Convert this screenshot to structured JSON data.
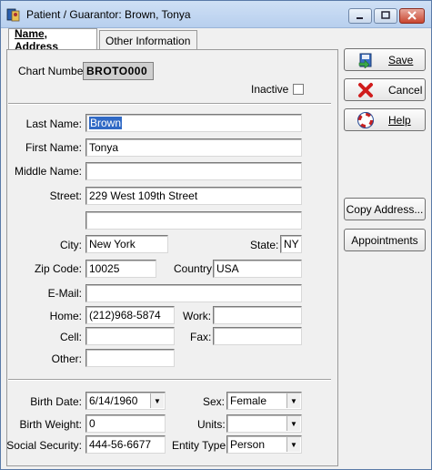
{
  "window": {
    "title": "Patient / Guarantor: Brown, Tonya",
    "minimize_icon": "minimize-icon",
    "maximize_icon": "maximize-icon",
    "close_icon": "close-icon"
  },
  "tabs": [
    {
      "label": "Name, Address",
      "active": true
    },
    {
      "label": "Other Information",
      "active": false
    }
  ],
  "chart": {
    "label": "Chart Number:",
    "value": "BROTO000"
  },
  "inactive": {
    "label": "Inactive",
    "checked": false
  },
  "name_address": {
    "last_name": {
      "label": "Last Name:",
      "value": "Brown"
    },
    "first_name": {
      "label": "First Name:",
      "value": "Tonya"
    },
    "middle_name": {
      "label": "Middle Name:",
      "value": ""
    },
    "street": {
      "label": "Street:",
      "value": "229 West 109th Street",
      "value2": ""
    },
    "city": {
      "label": "City:",
      "value": "New York"
    },
    "state": {
      "label": "State:",
      "value": "NY"
    },
    "zip": {
      "label": "Zip Code:",
      "value": "10025"
    },
    "country": {
      "label": "Country:",
      "value": "USA"
    },
    "email": {
      "label": "E-Mail:",
      "value": ""
    },
    "home": {
      "label": "Home:",
      "value": "(212)968-5874"
    },
    "work": {
      "label": "Work:",
      "value": ""
    },
    "cell": {
      "label": "Cell:",
      "value": ""
    },
    "fax": {
      "label": "Fax:",
      "value": ""
    },
    "other": {
      "label": "Other:",
      "value": ""
    }
  },
  "demographics": {
    "birth_date": {
      "label": "Birth Date:",
      "value": "6/14/1960"
    },
    "sex": {
      "label": "Sex:",
      "value": "Female"
    },
    "birth_weight": {
      "label": "Birth Weight:",
      "value": "0"
    },
    "units": {
      "label": "Units:",
      "value": ""
    },
    "ssn": {
      "label": "Social Security:",
      "value": "444-56-6677"
    },
    "entity_type": {
      "label": "Entity Type:",
      "value": "Person"
    }
  },
  "buttons": {
    "save": {
      "label": "Save",
      "icon": "save-icon"
    },
    "cancel": {
      "label": "Cancel",
      "icon": "cancel-x-icon"
    },
    "help": {
      "label": "Help",
      "icon": "help-lifebuoy-icon"
    },
    "copy_address": {
      "label": "Copy Address..."
    },
    "appointments": {
      "label": "Appointments"
    }
  },
  "colors": {
    "selection": "#316ac5",
    "title_bar": "#b7cfee",
    "close_button": "#c9452f"
  }
}
